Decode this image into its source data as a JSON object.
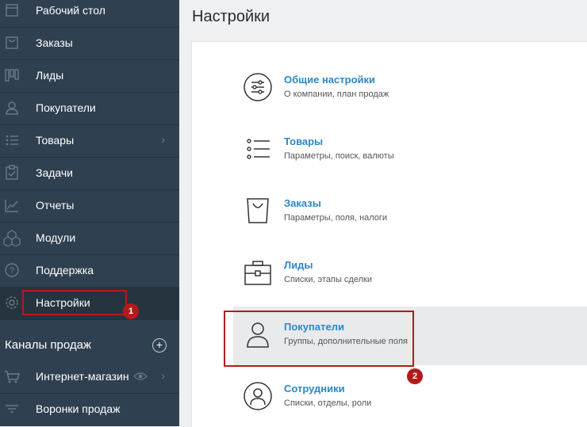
{
  "sidebar": {
    "items": [
      {
        "label": "Рабочий стол",
        "icon": "dashboard-icon"
      },
      {
        "label": "Заказы",
        "icon": "orders-icon"
      },
      {
        "label": "Лиды",
        "icon": "leads-icon"
      },
      {
        "label": "Покупатели",
        "icon": "customers-icon"
      },
      {
        "label": "Товары",
        "icon": "products-icon",
        "chevron": "›"
      },
      {
        "label": "Задачи",
        "icon": "tasks-icon"
      },
      {
        "label": "Отчеты",
        "icon": "reports-icon"
      },
      {
        "label": "Модули",
        "icon": "modules-icon"
      },
      {
        "label": "Поддержка",
        "icon": "support-icon"
      },
      {
        "label": "Настройки",
        "icon": "gear-icon",
        "active": true
      }
    ],
    "section": {
      "title": "Каналы продаж",
      "add": "+"
    },
    "channels": [
      {
        "label": "Интернет-магазин",
        "icon": "cart-icon",
        "chevron": "›"
      },
      {
        "label": "Воронки продаж",
        "icon": "funnel-icon"
      }
    ]
  },
  "main": {
    "title": "Настройки",
    "settings": [
      {
        "title": "Общие настройки",
        "desc": "О компании, план продаж",
        "icon": "sliders-icon"
      },
      {
        "title": "Товары",
        "desc": "Параметры, поиск, валюты",
        "icon": "list-icon"
      },
      {
        "title": "Заказы",
        "desc": "Параметры, поля, налоги",
        "icon": "bag-icon"
      },
      {
        "title": "Лиды",
        "desc": "Списки, этапы сделки",
        "icon": "briefcase-icon"
      },
      {
        "title": "Покупатели",
        "desc": "Группы, дополнительные поля",
        "icon": "user-icon",
        "active": true
      },
      {
        "title": "Сотрудники",
        "desc": "Списки, отделы, роли",
        "icon": "employee-icon"
      }
    ]
  },
  "annotations": {
    "badge1": "1",
    "badge2": "2"
  },
  "colors": {
    "sidebar": "#2f4050",
    "link": "#2b87c7",
    "annotation": "#b31b1b"
  }
}
